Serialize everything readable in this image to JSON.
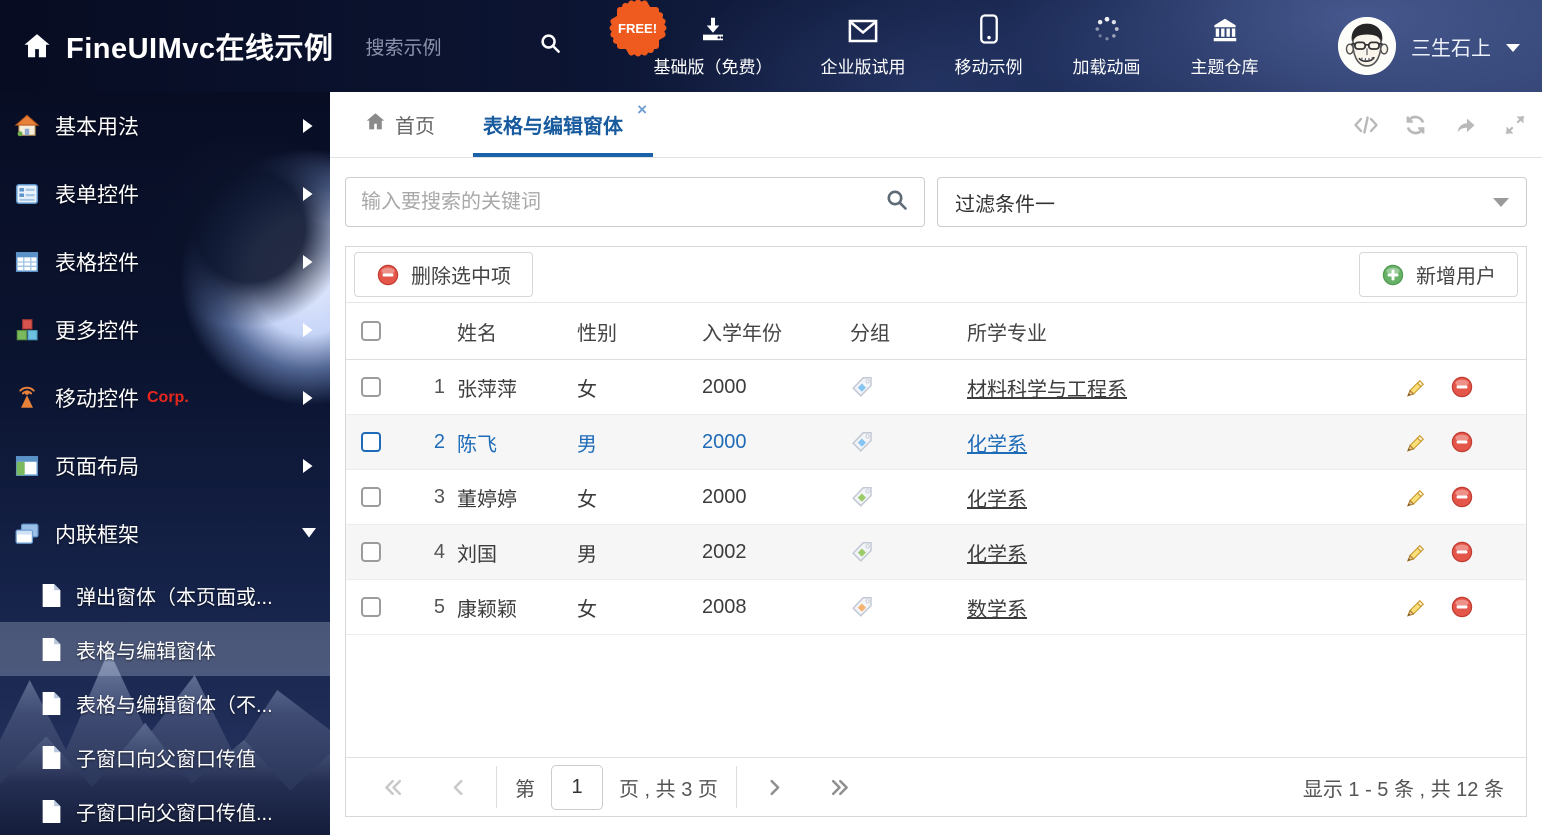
{
  "header": {
    "title": "FineUIMvc在线示例",
    "search_placeholder": "搜索示例",
    "free_badge": "FREE!",
    "nav": [
      {
        "label": "基础版（免费）",
        "icon": "download",
        "badge": true
      },
      {
        "label": "企业版试用",
        "icon": "envelope"
      },
      {
        "label": "移动示例",
        "icon": "phone"
      },
      {
        "label": "加载动画",
        "icon": "spinner"
      },
      {
        "label": "主题仓库",
        "icon": "bank"
      }
    ],
    "username": "三生石上"
  },
  "sidebar": {
    "items": [
      {
        "label": "基本用法",
        "icon": "house",
        "arrow": "right"
      },
      {
        "label": "表单控件",
        "icon": "form",
        "arrow": "right"
      },
      {
        "label": "表格控件",
        "icon": "grid",
        "arrow": "right"
      },
      {
        "label": "更多控件",
        "icon": "cubes",
        "arrow": "right"
      },
      {
        "label": "移动控件",
        "badge": "Corp.",
        "icon": "antenna",
        "arrow": "right"
      },
      {
        "label": "页面布局",
        "icon": "layout",
        "arrow": "right"
      },
      {
        "label": "内联框架",
        "icon": "frames",
        "arrow": "down"
      }
    ],
    "subitems": [
      {
        "label": "弹出窗体（本页面或..."
      },
      {
        "label": "表格与编辑窗体",
        "selected": true
      },
      {
        "label": "表格与编辑窗体（不..."
      },
      {
        "label": "子窗口向父窗口传值"
      },
      {
        "label": "子窗口向父窗口传值..."
      }
    ]
  },
  "tabs": {
    "home": "首页",
    "active": "表格与编辑窗体",
    "close": "×"
  },
  "filter": {
    "search_placeholder": "输入要搜索的关键词",
    "dropdown_value": "过滤条件一"
  },
  "toolbar": {
    "delete_label": "删除选中项",
    "add_label": "新增用户"
  },
  "table": {
    "headers": {
      "name": "姓名",
      "gender": "性别",
      "year": "入学年份",
      "group": "分组",
      "major": "所学专业"
    },
    "rows": [
      {
        "num": "1",
        "name": "张萍萍",
        "gender": "女",
        "year": "2000",
        "tag": "blue",
        "major": "材料科学与工程系"
      },
      {
        "num": "2",
        "name": "陈飞",
        "gender": "男",
        "year": "2000",
        "tag": "blue",
        "major": "化学系",
        "selected": true,
        "striped": true
      },
      {
        "num": "3",
        "name": "董婷婷",
        "gender": "女",
        "year": "2000",
        "tag": "green",
        "major": "化学系"
      },
      {
        "num": "4",
        "name": "刘国",
        "gender": "男",
        "year": "2002",
        "tag": "green",
        "major": "化学系",
        "striped": true
      },
      {
        "num": "5",
        "name": "康颖颖",
        "gender": "女",
        "year": "2008",
        "tag": "orange",
        "major": "数学系"
      }
    ]
  },
  "pagination": {
    "prefix": "第",
    "page": "1",
    "suffix": "页 , 共 3 页",
    "summary": "显示 1 - 5 条 , 共 12 条"
  },
  "colors": {
    "accent": "#1c62a8",
    "tag_blue": "#86c5f2",
    "tag_green": "#9ccb6b",
    "tag_orange": "#f6b26f",
    "delete_red": "#e4564a",
    "add_green": "#67b168"
  }
}
